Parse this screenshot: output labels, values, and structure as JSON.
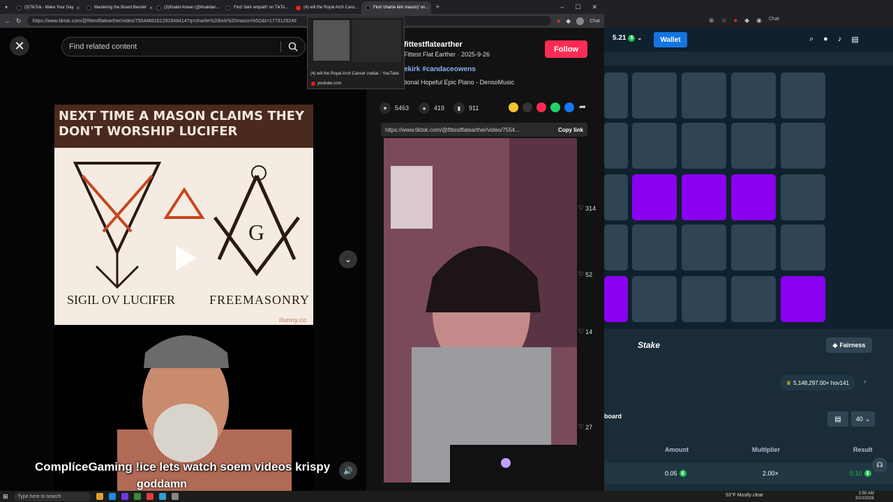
{
  "tabs": [
    {
      "label": "(3)TikTok - Make Your Day",
      "active": false
    },
    {
      "label": "Mastering the Board Bender",
      "active": false
    },
    {
      "label": "(3)Khalid Anwar (@khalidan...",
      "active": false
    },
    {
      "label": "Find 'dark empath' on TikTo...",
      "active": false
    },
    {
      "label": "(4) will the Royal Arch Canc...",
      "active": false,
      "youtube": true
    },
    {
      "label": "Find 'charlie kirk mason)' on...",
      "active": true
    }
  ],
  "url": "https://www.tiktok.com/@fittestflatearther/video/7554488161292848414?q=charlie%20kirk%20mason%5D&t=1773129248",
  "chat_label": "Chat",
  "search": {
    "placeholder": "Find related content"
  },
  "meme": {
    "banner": "NEXT TIME A MASON CLAIMS THEY DON'T WORSHIP LUCIFER",
    "left_caption": "SIGIL OV LUCIFER",
    "right_caption": "FREEMASONRY",
    "watermark": "ifunny.co",
    "g_letter": "G"
  },
  "captions": {
    "line1": "ComplíceGaming !ice lets watch soem videos krispy",
    "line2": "goddamn"
  },
  "yt_tooltip": {
    "title": "(4) will the Royal Arch Cancer zodiac - YouTube",
    "domain": "youtube.com"
  },
  "post": {
    "author": "fittestflatearther",
    "subtitle": "Fittest Flat Earther · 2025-9-26",
    "follow_label": "Follow",
    "tags": "ekirk #candaceowens",
    "music": "tional Hopeful Epic Piano - DensoMusic",
    "likes": "5463",
    "comments": "419",
    "saves": "911",
    "link": "https://www.tiktok.com/@fittestflatearther/video/7554...",
    "copy_label": "Copy link",
    "side_likes": [
      "314",
      "52",
      "14",
      "27"
    ]
  },
  "stake": {
    "balance": "5.21",
    "wallet_label": "Wallet",
    "logo": "Stake",
    "fairness_label": "Fairness",
    "big_win": "5,148,297.00× hov141",
    "leaderboard": "board",
    "count_value": "40",
    "headers": {
      "amount": "Amount",
      "multiplier": "Multiplier",
      "result": "Result"
    },
    "row": {
      "amount": "0.05",
      "multiplier": "2.00×",
      "result": "0.10"
    },
    "grid": [
      [
        0,
        0,
        0,
        0,
        0
      ],
      [
        0,
        0,
        0,
        0,
        0
      ],
      [
        0,
        1,
        1,
        1,
        0
      ],
      [
        0,
        0,
        0,
        0,
        0
      ],
      [
        1,
        0,
        0,
        0,
        1
      ]
    ],
    "colors": {
      "active": "#8a00f0",
      "tile": "#2f4553",
      "wallet": "#1475e1"
    }
  },
  "taskbar": {
    "search_placeholder": "Type here to search",
    "weather": "53°F Mostly clear",
    "time": "2:50 AM",
    "date": "3/10/2026"
  }
}
